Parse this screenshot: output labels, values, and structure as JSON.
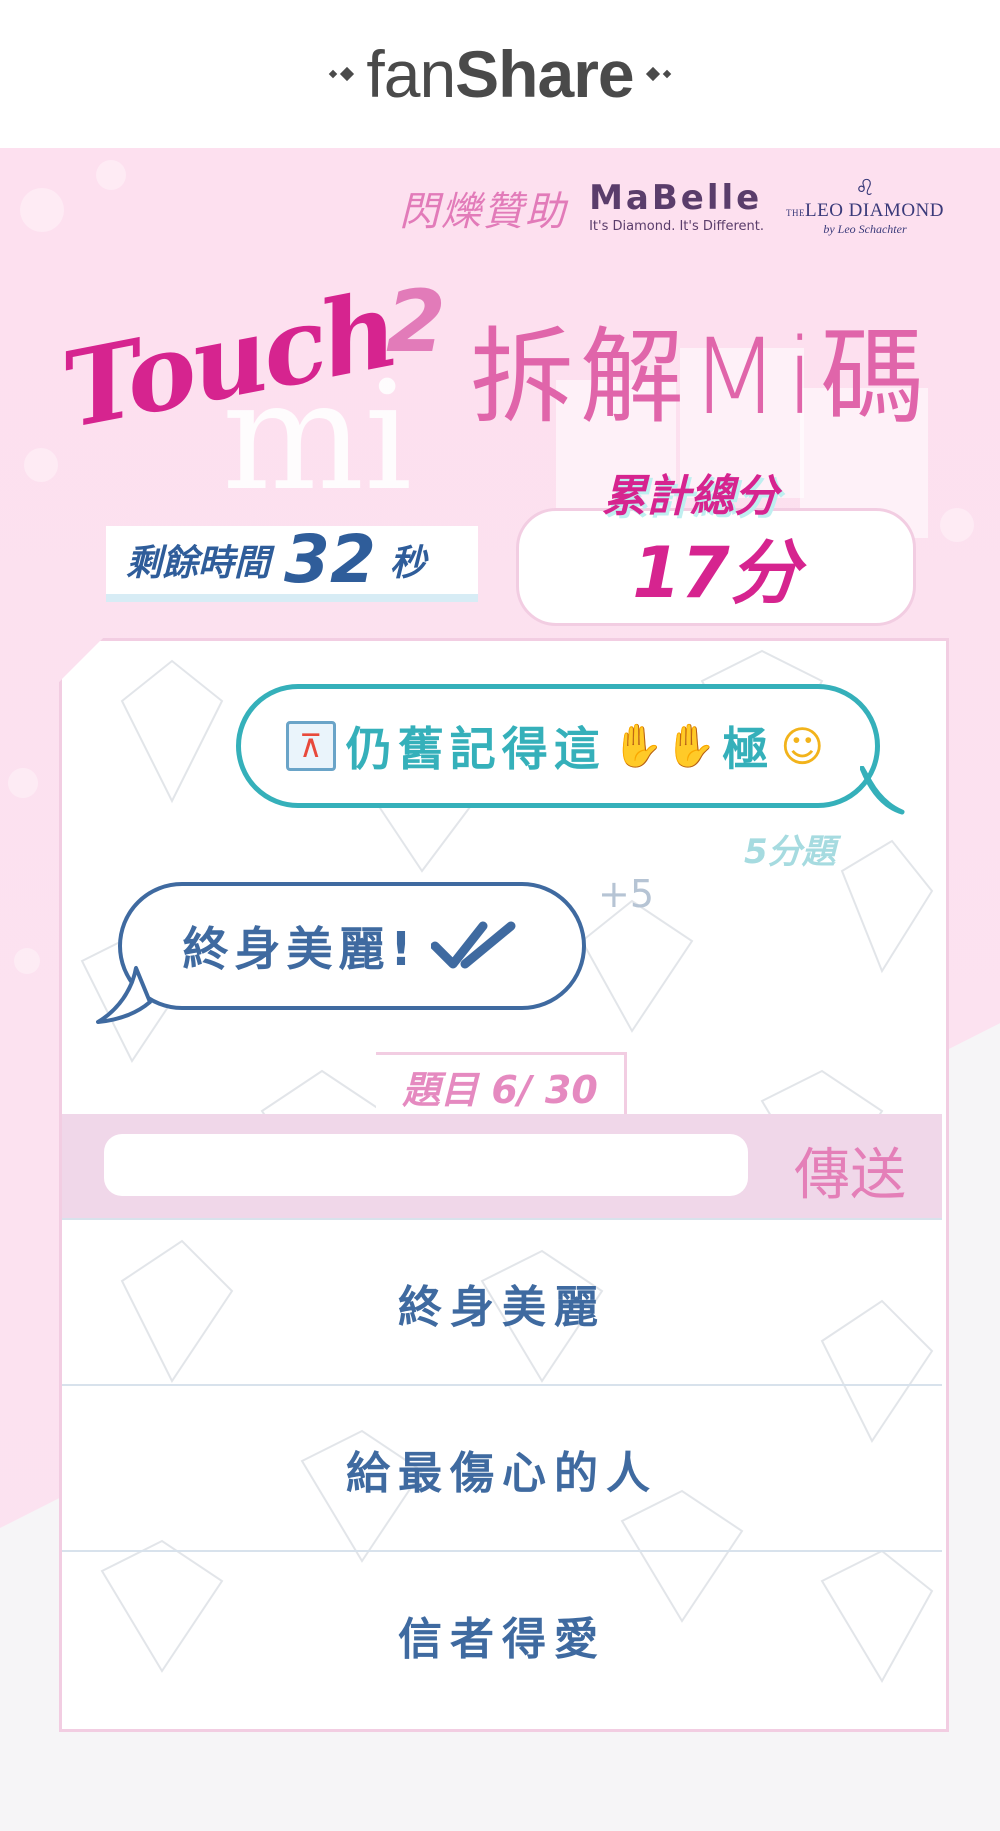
{
  "header": {
    "brand_fan": "fan",
    "brand_share": "Share"
  },
  "sponsor": {
    "label": "閃爍贊助",
    "mabelle_name": "MaBelle",
    "mabelle_tagline": "It's Diamond. It's Different.",
    "leo_the": "THE",
    "leo_name": "LEO DIAMOND",
    "leo_sub": "by Leo Schachter"
  },
  "banner": {
    "touch": "Touch",
    "mi": "mi",
    "two": "2",
    "title": "拆解Mi碼"
  },
  "timer": {
    "label": "剩餘時間",
    "value": "32",
    "unit": "秒"
  },
  "score": {
    "label": "累計總分",
    "value": "17分"
  },
  "question": {
    "text_1": "仍舊記得",
    "text_2": "這",
    "text_3": "極",
    "icons": [
      "tokyo-tower-icon",
      "open-hands-icon",
      "smiling-face-icon"
    ],
    "points": "5分題"
  },
  "last_answer": {
    "text": "終身美麗!",
    "bonus": "+5",
    "status": "correct"
  },
  "progress": {
    "label": "題目 6/ 30"
  },
  "input": {
    "value": "",
    "placeholder": "",
    "send_label": "傳送"
  },
  "choices": [
    {
      "label": "終身美麗"
    },
    {
      "label": "給最傷心的人"
    },
    {
      "label": "信者得愛"
    }
  ],
  "colors": {
    "accent_pink": "#d6248f",
    "teal": "#35b0ba",
    "navy": "#3f6aa0",
    "pink_bg": "#fde0ef"
  }
}
